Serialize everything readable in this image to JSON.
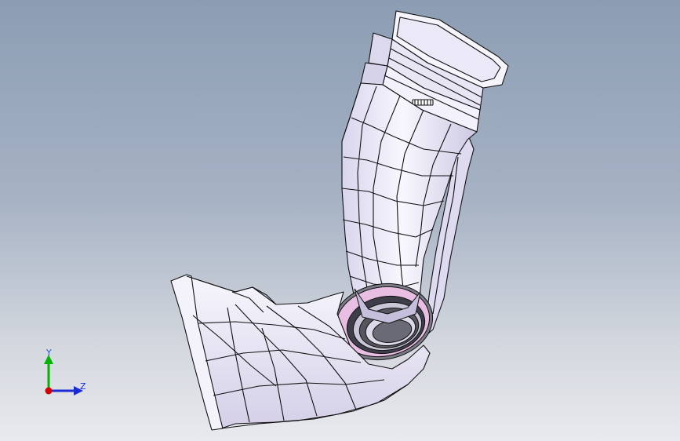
{
  "viewport": {
    "background_top": "#8c9db3",
    "background_bottom": "#e9eaee",
    "model": {
      "description_icon": "duct-part-icon",
      "fill_color": "#f2f0fb",
      "shade_color": "#cfcbe6",
      "edge_color": "#111111",
      "accent_color": "#e8bfe3"
    }
  },
  "triad": {
    "y_label": "Y",
    "z_label": "Z",
    "y_color": "#00b400",
    "z_color": "#1d2bd6",
    "x_color": "#d40000"
  }
}
